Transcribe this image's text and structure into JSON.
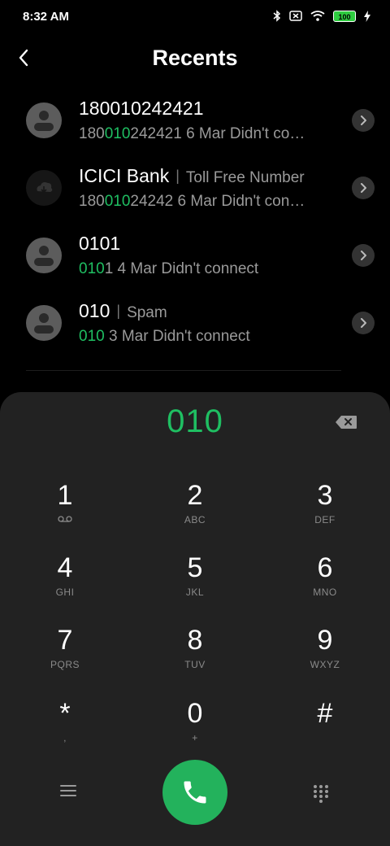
{
  "status_bar": {
    "time": "8:32 AM",
    "battery": "100",
    "icons": [
      "bluetooth-icon",
      "no-sim-icon",
      "wifi-icon",
      "battery-icon",
      "charging-icon"
    ]
  },
  "header": {
    "title": "Recents",
    "back_icon": "back-arrow-icon"
  },
  "recents": [
    {
      "name": "180010242421",
      "tag": "",
      "number_pre": "180",
      "number_hl": "010",
      "number_post": "242421",
      "detail": " 6 Mar Didn't co…",
      "avatar": "person-icon"
    },
    {
      "name": "ICICI Bank",
      "tag": "Toll Free Number",
      "number_pre": "180",
      "number_hl": "010",
      "number_post": "24242",
      "detail": " 6 Mar Didn't con…",
      "avatar": "cloud-icon"
    },
    {
      "name": "0101",
      "tag": "",
      "number_pre": "",
      "number_hl": "010",
      "number_post": "1",
      "detail": " 4 Mar Didn't connect",
      "avatar": "person-icon"
    },
    {
      "name": "010",
      "tag": "Spam",
      "number_pre": "",
      "number_hl": "010",
      "number_post": "",
      "detail": " 3 Mar Didn't connect",
      "avatar": "person-icon"
    }
  ],
  "dialpad": {
    "entry": "010",
    "keys": [
      {
        "digit": "1",
        "letters": ""
      },
      {
        "digit": "2",
        "letters": "ABC"
      },
      {
        "digit": "3",
        "letters": "DEF"
      },
      {
        "digit": "4",
        "letters": "GHI"
      },
      {
        "digit": "5",
        "letters": "JKL"
      },
      {
        "digit": "6",
        "letters": "MNO"
      },
      {
        "digit": "7",
        "letters": "PQRS"
      },
      {
        "digit": "8",
        "letters": "TUV"
      },
      {
        "digit": "9",
        "letters": "WXYZ"
      },
      {
        "digit": "*",
        "letters": ","
      },
      {
        "digit": "0",
        "letters": "+"
      },
      {
        "digit": "#",
        "letters": ""
      }
    ]
  },
  "colors": {
    "accent_green": "#1fbf62",
    "call_button": "#23b25c",
    "dialpad_bg": "#222222"
  }
}
